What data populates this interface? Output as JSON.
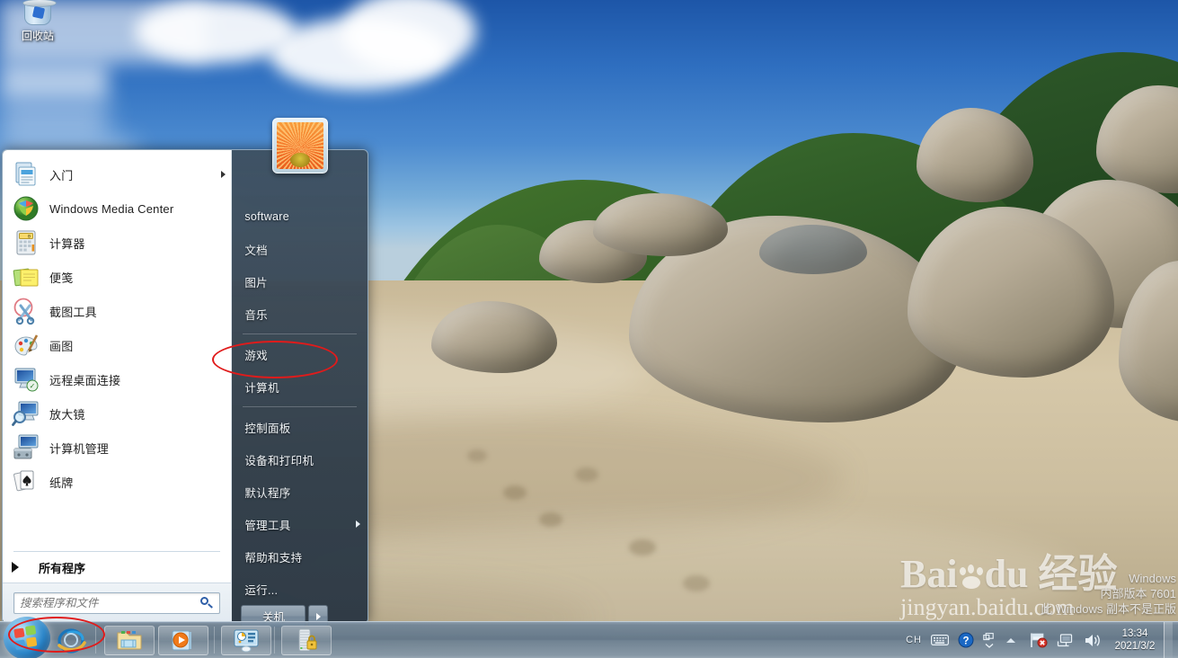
{
  "desktop": {
    "recycle_bin_label": "回收站",
    "activation_watermark": [
      "Windows",
      "内部版本 7601",
      "此 Windows 副本不是正版"
    ],
    "baidu_watermark": {
      "logo_left": "Bai",
      "logo_paw": "paw-icon",
      "logo_du": "du",
      "logo_cn": "经验",
      "url": "jingyan.baidu.com"
    }
  },
  "start_menu": {
    "user_picture": "gerbera-daisy-avatar",
    "programs": [
      {
        "label": "入门",
        "icon": "getting-started-icon",
        "has_submenu": true
      },
      {
        "label": "Windows Media Center",
        "icon": "windows-media-center-icon",
        "has_submenu": false
      },
      {
        "label": "计算器",
        "icon": "calculator-icon",
        "has_submenu": false
      },
      {
        "label": "便笺",
        "icon": "sticky-notes-icon",
        "has_submenu": false
      },
      {
        "label": "截图工具",
        "icon": "snipping-tool-icon",
        "has_submenu": false
      },
      {
        "label": "画图",
        "icon": "paint-icon",
        "has_submenu": false
      },
      {
        "label": "远程桌面连接",
        "icon": "remote-desktop-icon",
        "has_submenu": false
      },
      {
        "label": "放大镜",
        "icon": "magnifier-icon",
        "has_submenu": false
      },
      {
        "label": "计算机管理",
        "icon": "computer-management-icon",
        "has_submenu": false
      },
      {
        "label": "纸牌",
        "icon": "solitaire-icon",
        "has_submenu": false
      }
    ],
    "all_programs_label": "所有程序",
    "search_placeholder": "搜索程序和文件",
    "search_value": "",
    "search_icon": "magnifier-icon",
    "right_items": [
      {
        "label": "software",
        "separator_after": false
      },
      {
        "label": "文档",
        "separator_after": false
      },
      {
        "label": "图片",
        "separator_after": false
      },
      {
        "label": "音乐",
        "separator_after": true
      },
      {
        "label": "游戏",
        "separator_after": false
      },
      {
        "label": "计算机",
        "separator_after": true
      },
      {
        "label": "控制面板",
        "separator_after": false
      },
      {
        "label": "设备和打印机",
        "separator_after": false
      },
      {
        "label": "默认程序",
        "separator_after": false
      },
      {
        "label": "管理工具",
        "separator_after": false,
        "has_submenu": true
      },
      {
        "label": "帮助和支持",
        "separator_after": false
      },
      {
        "label": "运行...",
        "separator_after": false
      }
    ],
    "shutdown_label": "关机",
    "shutdown_arrow_icon": "chevron-right-icon"
  },
  "taskbar": {
    "start_orb_icon": "windows-logo-orb",
    "quick_launch": [
      {
        "name": "internet-explorer-icon",
        "label": "Internet Explorer"
      }
    ],
    "buttons": [
      {
        "name": "windows-explorer-icon",
        "label": "Windows 资源管理器"
      },
      {
        "name": "windows-media-player-icon",
        "label": "Windows Media Player"
      },
      {
        "name": "control-dashboard-icon",
        "label": "系统管理"
      },
      {
        "name": "server-security-icon",
        "label": "服务器安全"
      }
    ],
    "tray": {
      "ime": "CH",
      "keyboard_icon": "keyboard-icon",
      "help_icon": "help-question-icon",
      "stack_icon": "window-stack-icon",
      "show_hidden_icon": "chevron-up-icon",
      "action_center_icon": "flag-error-icon",
      "network_icon": "network-icon",
      "volume_icon": "speaker-icon"
    },
    "clock": {
      "time": "13:34",
      "date": "2021/3/2"
    },
    "show_desktop_label": "显示桌面"
  },
  "annotations": [
    {
      "name": "highlight-computer-item",
      "target": "计算机",
      "color": "#e01b1b"
    },
    {
      "name": "highlight-start-button",
      "target": "开始按钮",
      "color": "#e01b1b"
    }
  ],
  "colors": {
    "accent": "#e01b1b",
    "taskbar": "#6b8093",
    "menu_glass": "#36454f",
    "panel_white": "#ffffff"
  }
}
